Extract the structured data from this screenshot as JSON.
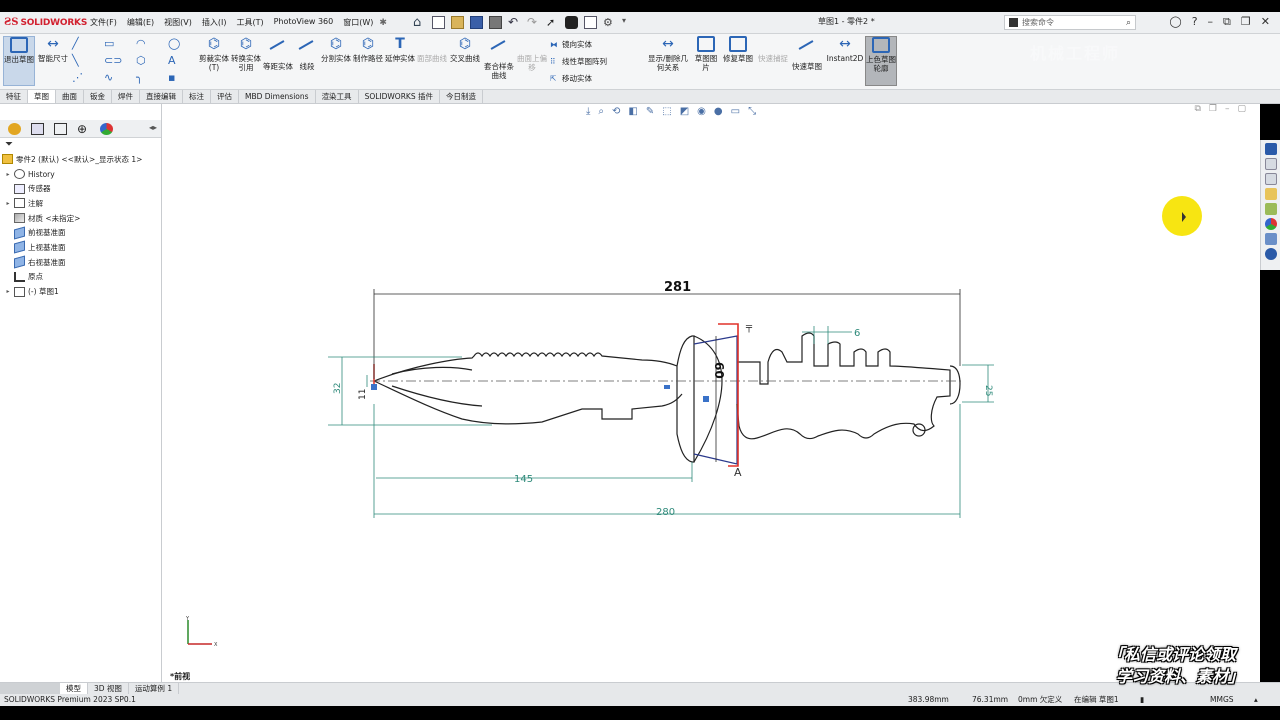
{
  "app": {
    "name": "SOLIDWORKS",
    "doc_title": "草图1 - 零件2 *",
    "menu": [
      "文件(F)",
      "编辑(E)",
      "视图(V)",
      "插入(I)",
      "工具(T)",
      "PhotoView 360",
      "窗口(W)"
    ],
    "search_placeholder": "搜索命令"
  },
  "ribbon": {
    "exit_sketch": "退出草图",
    "smart_dim": "智能尺寸",
    "trim": "剪裁实体(T)",
    "convert": "转换实体引用",
    "offset": "等距实体",
    "offset_surface": "线段",
    "split": "分割实体",
    "make_path": "制作路径",
    "extend": "延伸实体",
    "fillet_dim": "面部曲线",
    "intersection": "交叉曲线",
    "spline_on_surface": "套合样条曲线",
    "surface_disabled": "曲面上偏移",
    "mirror": "镜向实体",
    "linear_pattern": "线性草图阵列",
    "move": "移动实体",
    "display_relations": "显示/删除几何关系",
    "sketch_picture": "草图图片",
    "repair": "修复草图",
    "quick_snap": "快速捕捉",
    "rapid_sketch": "快速草图",
    "instant2d": "Instant2D",
    "shaded": "上色草图轮廓"
  },
  "tabs": [
    "特征",
    "草图",
    "曲面",
    "钣金",
    "焊件",
    "直接编辑",
    "标注",
    "评估",
    "MBD Dimensions",
    "渲染工具",
    "SOLIDWORKS 插件",
    "今日制造"
  ],
  "active_tab": "草图",
  "tree": {
    "root": "零件2 (默认) <<默认>_显示状态 1>",
    "items": [
      "History",
      "传感器",
      "注解",
      "材质 <未指定>",
      "前视基准面",
      "上视基准面",
      "右视基准面",
      "原点",
      "(-) 草图1"
    ]
  },
  "drawing": {
    "dims": {
      "overall_top": "281",
      "overall_bottom": "280",
      "blade_length": "145",
      "height_left": "32",
      "tip_height": "11",
      "guard_height": "60",
      "handle_height": "25",
      "groove_width": "6",
      "section_label": "A"
    }
  },
  "view_label": "*前视",
  "bottom_tabs": [
    "模型",
    "3D 视图",
    "运动算例 1"
  ],
  "status": {
    "product": "SOLIDWORKS Premium 2023 SP0.1",
    "x": "383.98mm",
    "y": "76.31mm",
    "z": "0mm 欠定义",
    "editing": "在编辑 草图1",
    "units": "MMGS"
  },
  "promo": [
    "「私信或评论领取",
    "学习资料、素材」"
  ],
  "watermark": "机械工程师"
}
